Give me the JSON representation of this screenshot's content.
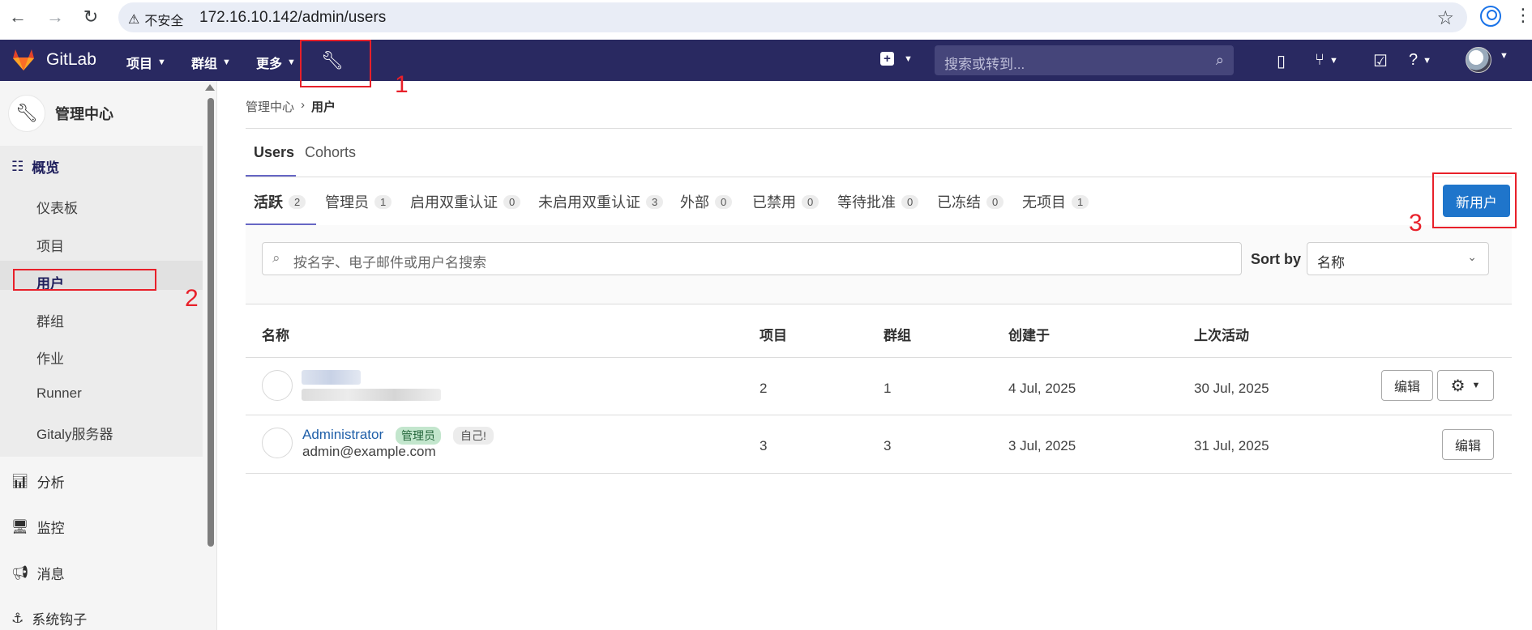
{
  "browser": {
    "back_icon": "arrow-left-icon",
    "forward_icon": "arrow-right-icon",
    "reload_icon": "reload-icon",
    "warning_icon": "warning-triangle-icon",
    "not_secure": "不安全",
    "url": "172.16.10.142/admin/users"
  },
  "topbar": {
    "brand": "GitLab",
    "nav": [
      "项目",
      "群组",
      "更多"
    ],
    "search_placeholder": "搜索或转到..."
  },
  "sidebar": {
    "title": "管理中心",
    "overview": "概览",
    "sub_items": [
      "仪表板",
      "项目",
      "用户",
      "群组",
      "作业",
      "Runner",
      "Gitaly服务器"
    ],
    "sections": [
      "分析",
      "监控",
      "消息",
      "系统钩子"
    ]
  },
  "breadcrumb": {
    "parent": "管理中心",
    "current": "用户"
  },
  "tabs": [
    "Users",
    "Cohorts"
  ],
  "filter_tabs": [
    {
      "label": "活跃",
      "count": "2"
    },
    {
      "label": "管理员",
      "count": "1"
    },
    {
      "label": "启用双重认证",
      "count": "0"
    },
    {
      "label": "未启用双重认证",
      "count": "3"
    },
    {
      "label": "外部",
      "count": "0"
    },
    {
      "label": "已禁用",
      "count": "0"
    },
    {
      "label": "等待批准",
      "count": "0"
    },
    {
      "label": "已冻结",
      "count": "0"
    },
    {
      "label": "无项目",
      "count": "1"
    }
  ],
  "new_user_button": "新用户",
  "search": {
    "placeholder": "按名字、电子邮件或用户名搜索"
  },
  "sort": {
    "label": "Sort by",
    "value": "名称"
  },
  "table": {
    "headers": [
      "名称",
      "项目",
      "群组",
      "创建于",
      "上次活动"
    ],
    "rows": [
      {
        "projects": "2",
        "groups": "1",
        "created": "4 Jul, 2025",
        "last_activity": "30 Jul, 2025",
        "edit": "编辑"
      },
      {
        "name": "Administrator",
        "badge_admin": "管理员",
        "badge_self": "自己!",
        "email": "admin@example.com",
        "projects": "3",
        "groups": "3",
        "created": "3 Jul, 2025",
        "last_activity": "31 Jul, 2025",
        "edit": "编辑"
      }
    ]
  },
  "annotations": [
    "1",
    "2",
    "3"
  ],
  "colors": {
    "topbar": "#292961",
    "primary_button": "#1f75cb",
    "annotation": "#e8202a"
  }
}
